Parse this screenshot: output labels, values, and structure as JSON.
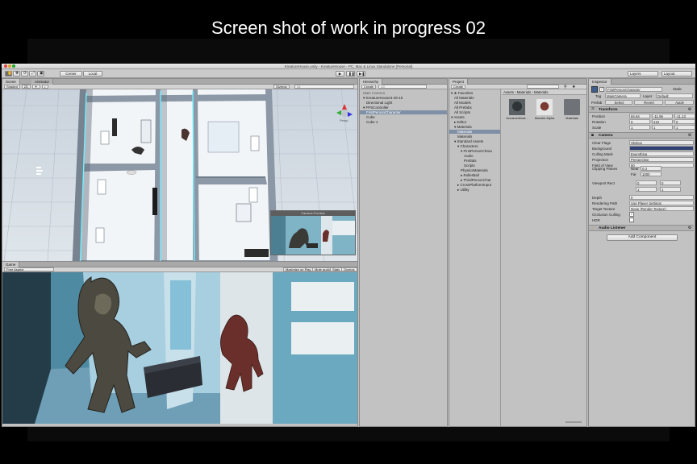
{
  "caption": "Screen shot of work in progress 02",
  "window": {
    "title": "KreatureHouse.unity - KreatureHouse - PC, Mac & Linux Standalone (Personal)"
  },
  "toolbar": {
    "tools": [
      "✋",
      "✥",
      "⟳",
      "⤢",
      "▣"
    ],
    "center_label": "Center",
    "local_label": "Local",
    "play": "▶",
    "pause": "❚❚",
    "step": "▶❚",
    "layers_label": "Layers",
    "layout_label": "Layout"
  },
  "scene": {
    "tabs": [
      "Scene",
      "Animator"
    ],
    "shading": "Shaded",
    "mode_2d": "2D",
    "gizmos": "Gizmos",
    "search_placeholder": "All",
    "persp_label": "Persp",
    "preview_title": "Camera Preview"
  },
  "game": {
    "tab": "Game",
    "aspect": "Free Aspect",
    "buttons": [
      "Maximize on Play",
      "Mute audio",
      "Stats",
      "Gizmos"
    ]
  },
  "hierarchy": {
    "tab": "Hierarchy",
    "create": "Create",
    "search_placeholder": "All",
    "items": [
      {
        "label": "Main Camera",
        "indent": 0,
        "selected": false,
        "muted": true
      },
      {
        "label": "▾ KreatureHouse3-28-15",
        "indent": 0,
        "selected": false,
        "muted": false
      },
      {
        "label": "Directional Light",
        "indent": 1,
        "selected": false,
        "muted": false
      },
      {
        "label": "▾ FPSController",
        "indent": 0,
        "selected": false,
        "muted": false
      },
      {
        "label": "FirstPersonCharacter",
        "indent": 1,
        "selected": true,
        "muted": false
      },
      {
        "label": "Cube",
        "indent": 1,
        "selected": false,
        "muted": false
      },
      {
        "label": "Cube 1",
        "indent": 1,
        "selected": false,
        "muted": false
      }
    ]
  },
  "project": {
    "tab": "Project",
    "create": "Create",
    "breadcrumb": "Assets › Materials › Materials",
    "tree": [
      {
        "label": "▾ ★ Favorites",
        "indent": 0,
        "selected": false
      },
      {
        "label": "All Materials",
        "indent": 1,
        "selected": false
      },
      {
        "label": "All Models",
        "indent": 1,
        "selected": false
      },
      {
        "label": "All Prefabs",
        "indent": 1,
        "selected": false
      },
      {
        "label": "All Scripts",
        "indent": 1,
        "selected": false
      },
      {
        "label": "▾ Assets",
        "indent": 0,
        "selected": false
      },
      {
        "label": "▸ Editor",
        "indent": 1,
        "selected": false
      },
      {
        "label": "▾ Materials",
        "indent": 1,
        "selected": false
      },
      {
        "label": "Materials",
        "indent": 2,
        "selected": true
      },
      {
        "label": "Materials",
        "indent": 2,
        "selected": false
      },
      {
        "label": "▾ Standard Assets",
        "indent": 1,
        "selected": false
      },
      {
        "label": "▾ Characters",
        "indent": 2,
        "selected": false
      },
      {
        "label": "▾ FirstPersonChara",
        "indent": 3,
        "selected": false
      },
      {
        "label": "Audio",
        "indent": 4,
        "selected": false
      },
      {
        "label": "Prefabs",
        "indent": 4,
        "selected": false
      },
      {
        "label": "Scripts",
        "indent": 4,
        "selected": false
      },
      {
        "label": "PhysicsMaterials",
        "indent": 3,
        "selected": false
      },
      {
        "label": "▸ RollerBall",
        "indent": 3,
        "selected": false
      },
      {
        "label": "▸ ThirdPersonChar",
        "indent": 3,
        "selected": false
      },
      {
        "label": "▸ CrossPlatformInput",
        "indent": 2,
        "selected": false
      },
      {
        "label": "▸ Utility",
        "indent": 2,
        "selected": false
      }
    ],
    "assets": [
      {
        "label": "Unnamed/mat...",
        "kind": "thumb-dark"
      },
      {
        "label": "Monster Alpha",
        "kind": "thumb-creature"
      },
      {
        "label": "Materials",
        "kind": "folder"
      }
    ]
  },
  "inspector": {
    "tab": "Inspector",
    "object_name": "FirstPersonCharacter",
    "static_label": "Static",
    "tag_label": "Tag",
    "tag_value": "MainCamera",
    "layer_label": "Layer",
    "layer_value": "Default",
    "prefab_label": "Prefab",
    "prefab_buttons": [
      "Select",
      "Revert",
      "Apply"
    ],
    "transform": {
      "title": "Transform",
      "position_label": "Position",
      "position": [
        "84.64",
        "-11.96",
        "-11.13"
      ],
      "rotation_label": "Rotation",
      "rotation": [
        "0",
        "210",
        "0"
      ],
      "scale_label": "Scale",
      "scale": [
        "1",
        "1",
        "1"
      ]
    },
    "camera": {
      "title": "Camera",
      "fields": [
        {
          "label": "Clear Flags",
          "value": "Skybox"
        },
        {
          "label": "Background",
          "value": ""
        },
        {
          "label": "Culling Mask",
          "value": "Everything"
        },
        {
          "label": "Projection",
          "value": "Perspective"
        },
        {
          "label": "Field of View",
          "value": "60"
        }
      ],
      "clipping_label": "Clipping Planes",
      "near_label": "Near",
      "near": "0.3",
      "far_label": "Far",
      "far": "1000",
      "viewport_label": "Viewport Rect",
      "viewport": {
        "x": "0",
        "y": "0",
        "w": "1",
        "h": "1"
      },
      "depth_label": "Depth",
      "depth": "0",
      "rendering_path_label": "Rendering Path",
      "rendering_path": "Use Player Settings",
      "target_texture_label": "Target Texture",
      "target_texture": "None (Render Texture)",
      "occlusion_label": "Occlusion Culling",
      "hdr_label": "HDR"
    },
    "audio_listener": "Audio Listener",
    "add_component": "Add Component"
  },
  "colors": {
    "selection": "#7f8fa6",
    "panel": "#c2c2c2",
    "background_swatch": "#2e3f72"
  }
}
